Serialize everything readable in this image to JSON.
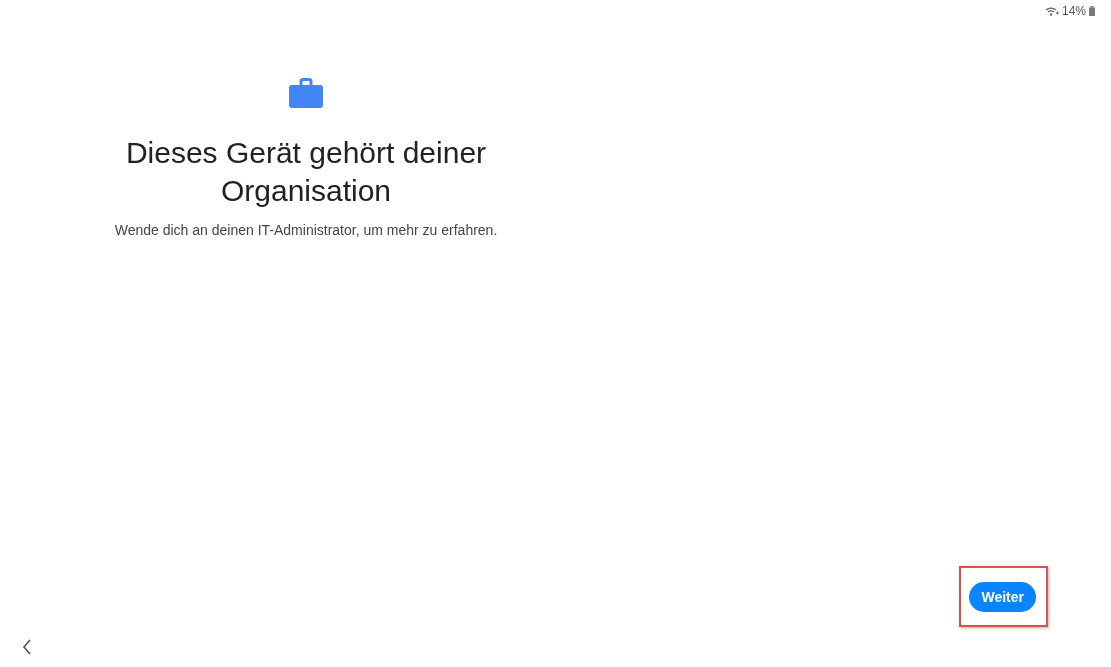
{
  "status_bar": {
    "battery": "14%"
  },
  "title": "Dieses Gerät gehört deiner Organisation",
  "subtitle": "Wende dich an deinen IT-Administrator, um mehr zu erfahren.",
  "next_button": {
    "label": "Weiter",
    "highlighted": true
  }
}
